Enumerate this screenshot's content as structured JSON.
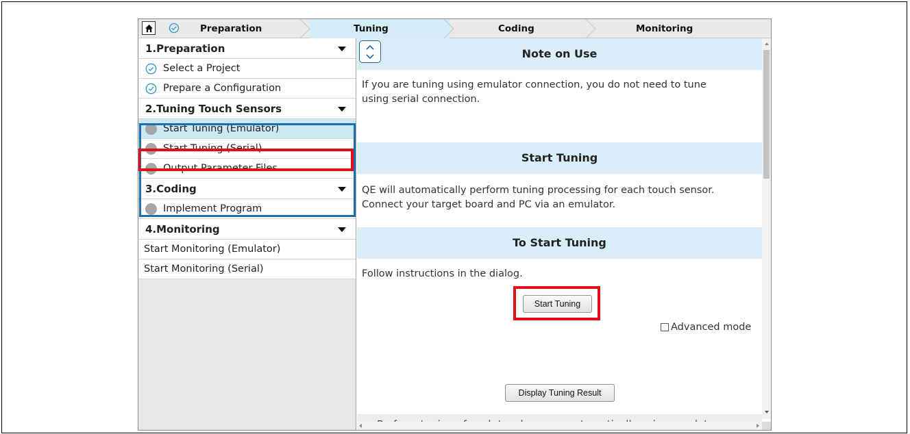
{
  "breadcrumb": {
    "steps": [
      {
        "label": "Preparation"
      },
      {
        "label": "Tuning"
      },
      {
        "label": "Coding"
      },
      {
        "label": "Monitoring"
      }
    ],
    "active_step": "Tuning"
  },
  "sidebar": {
    "sections": [
      {
        "title": "1.Preparation",
        "items": [
          {
            "label": "Select a Project",
            "status": "done"
          },
          {
            "label": "Prepare a Configuration",
            "status": "done"
          }
        ]
      },
      {
        "title": "2.Tuning Touch Sensors",
        "items": [
          {
            "label": "Start Tuning (Emulator)",
            "status": "pending"
          },
          {
            "label": "Start Tuning (Serial)",
            "status": "pending"
          },
          {
            "label": "Output Parameter Files",
            "status": "pending"
          }
        ]
      },
      {
        "title": "3.Coding",
        "items": [
          {
            "label": "Implement Program",
            "status": "pending"
          }
        ]
      },
      {
        "title": "4.Monitoring",
        "items": [
          {
            "label": "Start Monitoring (Emulator)"
          },
          {
            "label": "Start Monitoring (Serial)"
          }
        ]
      }
    ]
  },
  "content": {
    "note_title": "Note on Use",
    "note_text_1": "If you are tuning using emulator connection, you do not need to tune",
    "note_text_2": "using serial connection.",
    "start_title": "Start Tuning",
    "start_text_1": "QE will automatically perform tuning processing for each touch sensor.",
    "start_text_2": "Connect your target board and PC via an emulator.",
    "to_start_title": "To Start Tuning",
    "follow_text": "Follow instructions in the dialog.",
    "start_button": "Start Tuning",
    "advanced_mode_label": "Advanced mode",
    "advanced_mode_checked": false,
    "display_result_button": "Display Tuning Result",
    "status_text": "Perform tuning of each touch sensor automatically using emulator"
  },
  "colors": {
    "banner_bg": "#d9eef8",
    "highlight_red": "#e0101a",
    "highlight_blue": "#1b6fae",
    "done_check": "#2e9ad0",
    "pending_dot": "#a5a5a5"
  }
}
